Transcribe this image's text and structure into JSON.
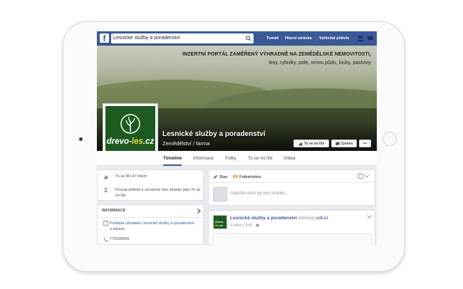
{
  "topbar": {
    "search_value": "Lesnické služby a poradenství",
    "nav": [
      "Tomáš",
      "Hlavní stránka",
      "Vyhledat přátele"
    ]
  },
  "cover": {
    "tagline_line1": "INZERTNÍ PORTÁL ZAMĚŘENÝ VÝHRADNĚ NA ZEMĚDĚLSKÉ NEMOVITOSTI,",
    "tagline_line2": "lesy, rybníky, pole, ornou půdu, louky, pastviny",
    "page_name": "Lesnické služby a poradenství",
    "page_category": "Zemědělství / farma",
    "logo_main": "drevo-",
    "logo_accent": "les",
    "logo_suffix": ".cz",
    "like_button": "To se mi líbí",
    "message_button": "Zpráva",
    "more_button": "•••"
  },
  "tabs": [
    "Timeline",
    "Informace",
    "Fotky",
    "To se mi líbí",
    "Videa"
  ],
  "left": {
    "likes_text": "To se líbí 47 lidem",
    "invite_text_1": "Pozvat přátele k označení této stránky jako To se",
    "invite_text_2": "mi líbí",
    "info_title": "INFORMACE",
    "ask_address_1": "Požádat uživatele Lesnické služby a poradenství",
    "ask_address_2": "o adresu",
    "phone": "775939555"
  },
  "composer": {
    "tab_status": "Stav",
    "tab_photo": "Fotka/video",
    "placeholder": "Napište něco na tuto stránku..."
  },
  "post": {
    "author": "Lesnické služby a poradenství",
    "verb": "sdílel(a)",
    "object": "odkaz",
    "time": "4 leden v 9:40 · "
  },
  "colors": {
    "facebook_blue": "#3b5998",
    "page_background": "#e9ebee",
    "logo_green": "#1d5a1f",
    "logo_accent_yellow": "#f0d23c"
  }
}
